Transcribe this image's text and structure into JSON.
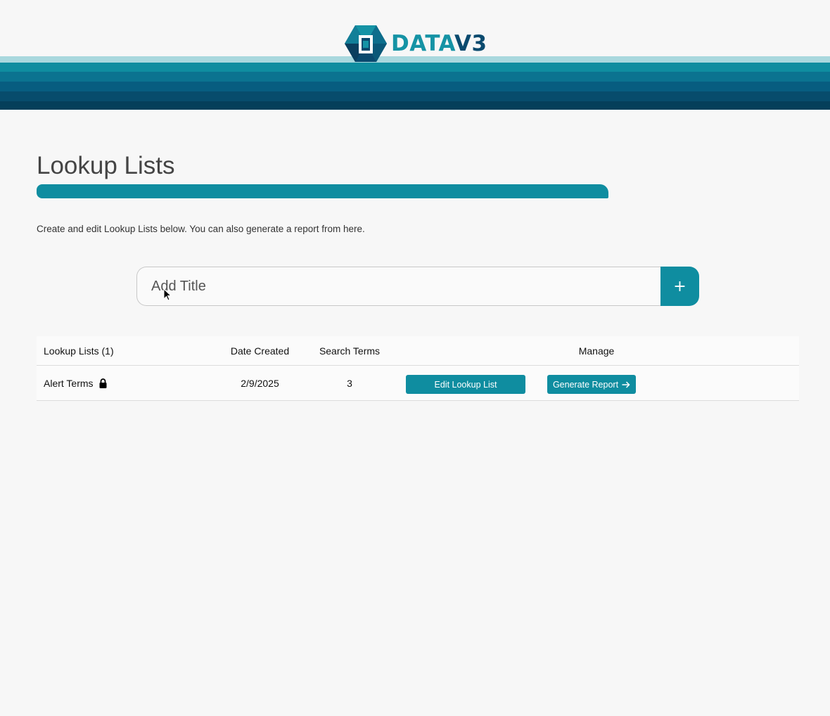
{
  "header": {
    "logo_text_primary": "DATA",
    "logo_text_secondary": "V3"
  },
  "page": {
    "title": "Lookup Lists",
    "description": "Create and edit Lookup Lists below. You can also generate a report from here."
  },
  "add_form": {
    "placeholder": "Add Title",
    "add_button_label": "+"
  },
  "table": {
    "headers": {
      "name": "Lookup Lists (1)",
      "date": "Date Created",
      "terms": "Search Terms",
      "manage": "Manage"
    },
    "rows": [
      {
        "name": "Alert Terms",
        "locked_icon": "lock-icon",
        "date_created": "2/9/2025",
        "search_terms": "3",
        "edit_label": "Edit Lookup List",
        "report_label": "Generate Report",
        "report_icon": "arrow-right-icon"
      }
    ]
  },
  "colors": {
    "accent": "#0f8da0",
    "dark_blue": "#0a4a6e",
    "background": "#f7f7f7"
  }
}
